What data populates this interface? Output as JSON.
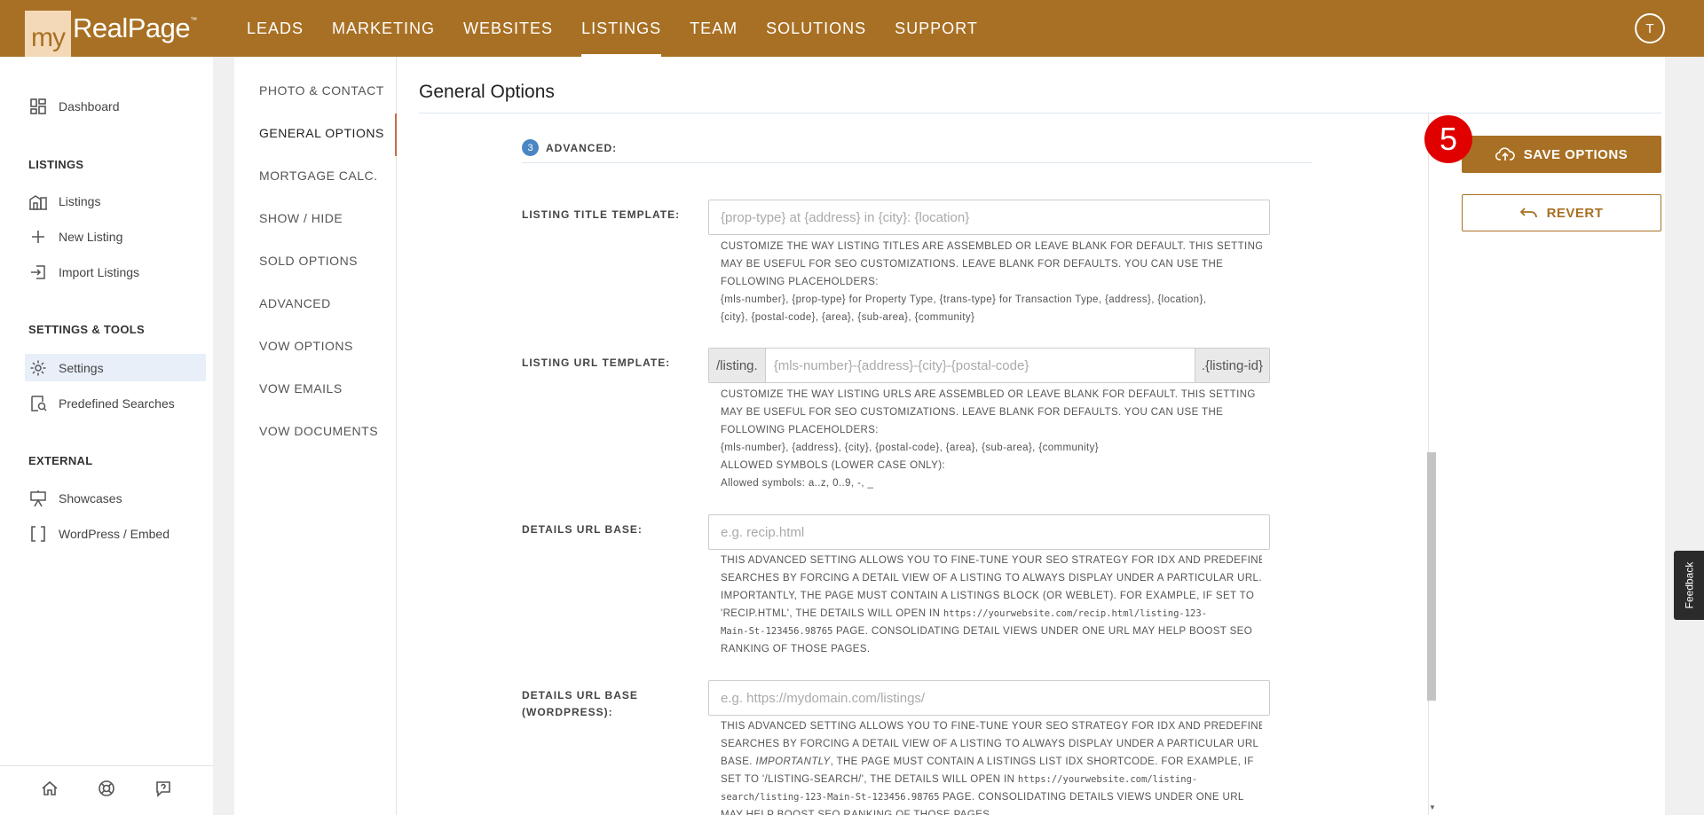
{
  "brand": {
    "prefix": "my",
    "name": "RealPage",
    "tm": "™"
  },
  "nav": {
    "items": [
      {
        "label": "LEADS"
      },
      {
        "label": "MARKETING"
      },
      {
        "label": "WEBSITES"
      },
      {
        "label": "LISTINGS",
        "active": true
      },
      {
        "label": "TEAM"
      },
      {
        "label": "SOLUTIONS"
      },
      {
        "label": "SUPPORT"
      }
    ],
    "user_initial": "T"
  },
  "sidebar": {
    "dashboard": "Dashboard",
    "listings_heading": "LISTINGS",
    "listings": "Listings",
    "new_listing": "New Listing",
    "import_listings": "Import Listings",
    "settings_heading": "SETTINGS & TOOLS",
    "settings": "Settings",
    "predefined_searches": "Predefined Searches",
    "external_heading": "EXTERNAL",
    "showcases": "Showcases",
    "wordpress": "WordPress / Embed"
  },
  "subnav": {
    "items": [
      "PHOTO & CONTACT",
      "GENERAL OPTIONS",
      "MORTGAGE CALC.",
      "SHOW / HIDE",
      "SOLD OPTIONS",
      "ADVANCED",
      "VOW OPTIONS",
      "VOW EMAILS",
      "VOW DOCUMENTS"
    ],
    "active": "GENERAL OPTIONS"
  },
  "page": {
    "title": "General Options",
    "section_number": "3",
    "section_label": "ADVANCED:"
  },
  "fields": {
    "title_template": {
      "label": "LISTING TITLE TEMPLATE:",
      "placeholder": "{prop-type} at {address} in {city}: {location}",
      "help": [
        "CUSTOMIZE THE WAY LISTING TITLES ARE ASSEMBLED OR LEAVE BLANK FOR DEFAULT. THIS SETTING",
        "MAY BE USEFUL FOR SEO CUSTOMIZATIONS. LEAVE BLANK FOR DEFAULTS. YOU CAN USE THE",
        "FOLLOWING PLACEHOLDERS:",
        "{mls-number}, {prop-type} for Property Type, {trans-type} for Transaction Type, {address}, {location},",
        "{city}, {postal-code}, {area}, {sub-area}, {community}"
      ]
    },
    "url_template": {
      "label": "LISTING URL TEMPLATE:",
      "prefix": "/listing.",
      "placeholder": "{mls-number}-{address}-{city}-{postal-code}",
      "suffix": ".{listing-id}",
      "help": [
        "CUSTOMIZE THE WAY LISTING URLS ARE ASSEMBLED OR LEAVE BLANK FOR DEFAULT. THIS SETTING",
        "MAY BE USEFUL FOR SEO CUSTOMIZATIONS. LEAVE BLANK FOR DEFAULTS. YOU CAN USE THE",
        "FOLLOWING PLACEHOLDERS:",
        "{mls-number}, {address}, {city}, {postal-code}, {area}, {sub-area}, {community}",
        "ALLOWED SYMBOLS (LOWER CASE ONLY):",
        "Allowed symbols: a..z, 0..9, -, _"
      ]
    },
    "details_base": {
      "label": "DETAILS URL BASE:",
      "placeholder": "e.g. recip.html",
      "help_1": "THIS ADVANCED SETTING ALLOWS YOU TO FINE-TUNE YOUR SEO STRATEGY FOR IDX AND PREDEFINED",
      "help_2": "SEARCHES BY FORCING A DETAIL VIEW OF A LISTING TO ALWAYS DISPLAY UNDER A PARTICULAR URL.",
      "help_3": "IMPORTANTLY, THE PAGE MUST CONTAIN A LISTINGS BLOCK (OR WEBLET). FOR EXAMPLE, IF SET TO",
      "help_4a": "'RECIP.HTML', THE DETAILS WILL OPEN IN ",
      "help_4b": "https://yourwebsite.com/recip.html/listing-123-",
      "help_5a": "Main-St-123456.98765",
      "help_5b": " PAGE. CONSOLIDATING DETAIL VIEWS UNDER ONE URL MAY HELP BOOST SEO",
      "help_6": "RANKING OF THOSE PAGES."
    },
    "details_base_wp": {
      "label": "DETAILS URL BASE (WORDPRESS):",
      "placeholder": "e.g. https://mydomain.com/listings/",
      "help_1": "THIS ADVANCED SETTING ALLOWS YOU TO FINE-TUNE YOUR SEO STRATEGY FOR IDX AND PREDEFINED",
      "help_2": "SEARCHES BY FORCING A DETAIL VIEW OF A LISTING TO ALWAYS DISPLAY UNDER A PARTICULAR URL",
      "help_3a": "BASE. ",
      "help_3b": "IMPORTANTLY",
      "help_3c": ", THE PAGE MUST CONTAIN A LISTINGS LIST IDX SHORTCODE. FOR EXAMPLE, IF",
      "help_4a": "SET TO '/LISTING-SEARCH/', THE DETAILS WILL OPEN IN ",
      "help_4b": "https://yourwebsite.com/listing-",
      "help_5a": "search/listing-123-Main-St-123456.98765",
      "help_5b": " PAGE. CONSOLIDATING DETAILS VIEWS UNDER ONE URL",
      "help_6": "MAY HELP BOOST SEO RANKING OF THOSE PAGES."
    }
  },
  "actions": {
    "save": "SAVE OPTIONS",
    "revert": "REVERT",
    "badge": "5",
    "feedback": "Feedback"
  },
  "colors": {
    "brand": "#a87024",
    "badge": "#e00000",
    "step": "#4a86c4"
  }
}
